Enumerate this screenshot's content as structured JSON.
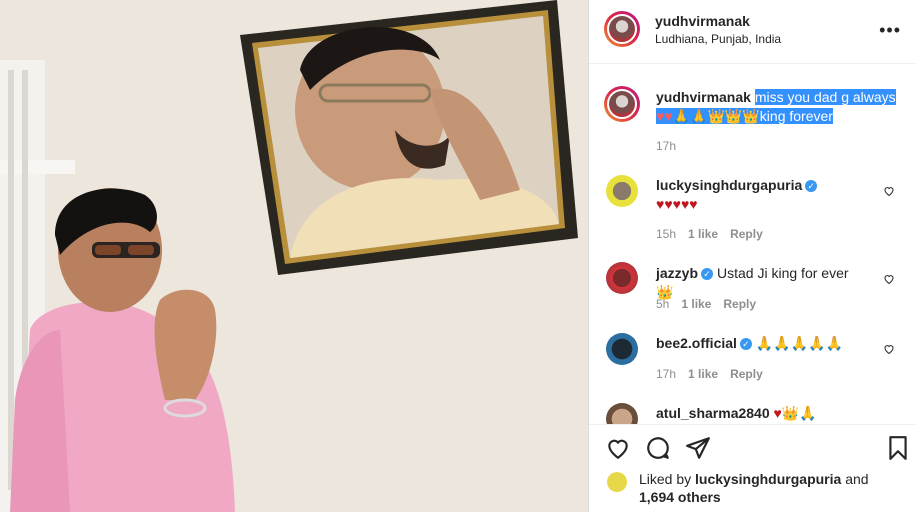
{
  "post": {
    "username": "yudhvirmanak",
    "location": "Ludhiana, Punjab, India",
    "more_icon": "more-horizontal-icon"
  },
  "caption": {
    "username": "yudhvirmanak",
    "text": "miss you dad g always",
    "emoji_line": "♥♥🙏🙏👑👑👑",
    "text_end": "king forever",
    "time": "17h"
  },
  "comments": [
    {
      "username": "luckysinghdurgapuria",
      "verified": true,
      "text": "♥♥♥♥♥",
      "time": "15h",
      "likes": "1 like",
      "reply": "Reply"
    },
    {
      "username": "jazzyb",
      "verified": true,
      "text": "Ustad Ji king for ever 👑",
      "time": "5h",
      "likes": "1 like",
      "reply": "Reply"
    },
    {
      "username": "bee2.official",
      "verified": true,
      "text": "🙏🙏🙏🙏🙏",
      "time": "17h",
      "likes": "1 like",
      "reply": "Reply"
    },
    {
      "username": "atul_sharma2840",
      "verified": false,
      "text": "♥👑🙏",
      "time": "",
      "likes": "",
      "reply": ""
    }
  ],
  "likes_summary": {
    "prefix": "Liked by",
    "user": "luckysinghdurgapuria",
    "and": "and",
    "others": "1,694 others"
  },
  "colors": {
    "accent_blue": "#3897f0",
    "selection": "#3390ff",
    "heart_red": "#c0161e",
    "muted": "#8e8e8e"
  }
}
